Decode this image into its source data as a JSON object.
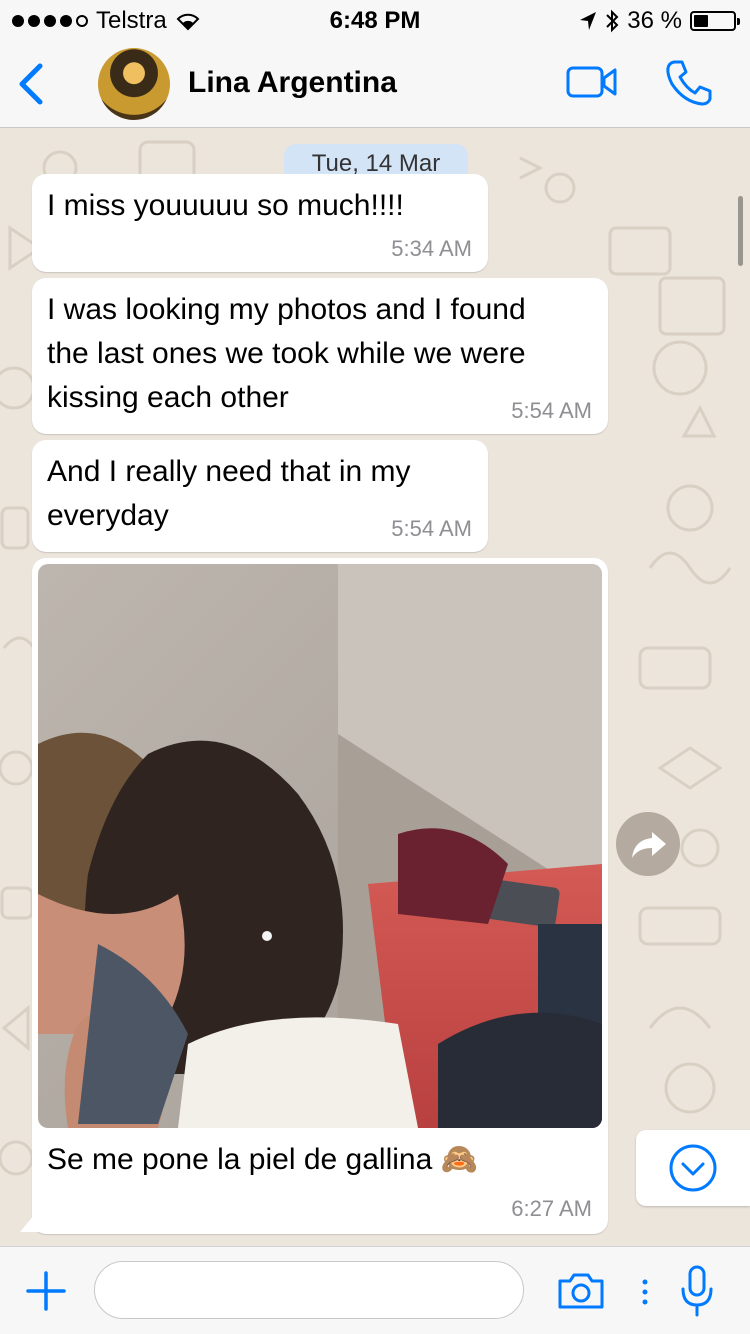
{
  "status": {
    "carrier": "Telstra",
    "time": "6:48 PM",
    "battery": "36 %",
    "battery_level": 0.36
  },
  "header": {
    "contact_name": "Lina Argentina"
  },
  "chat": {
    "date_label": "Tue, 14 Mar",
    "messages": [
      {
        "text": "I miss youuuuu so much!!!!",
        "time": "5:34 AM"
      },
      {
        "text": "I was looking my photos and I found\nthe last ones we took while we were\nkissing each other",
        "time": "5:54 AM"
      },
      {
        "text": "And I really need that in my\neveryday",
        "time": "5:54 AM"
      },
      {
        "caption": "Se me pone la piel de gallina 🙈",
        "time": "6:27 AM"
      }
    ]
  },
  "input": {
    "placeholder": ""
  },
  "colors": {
    "accent": "#007aff",
    "bubble": "#ffffff",
    "wallpaper": "#ece5dc",
    "bar": "#f7f7f7"
  },
  "icons": [
    "signal-dots-icon",
    "wifi-icon",
    "location-arrow-icon",
    "bluetooth-icon",
    "battery-icon",
    "back-chevron-icon",
    "video-call-icon",
    "phone-icon",
    "forward-icon",
    "scroll-down-icon",
    "plus-icon",
    "camera-icon",
    "more-dots-icon",
    "microphone-icon"
  ]
}
